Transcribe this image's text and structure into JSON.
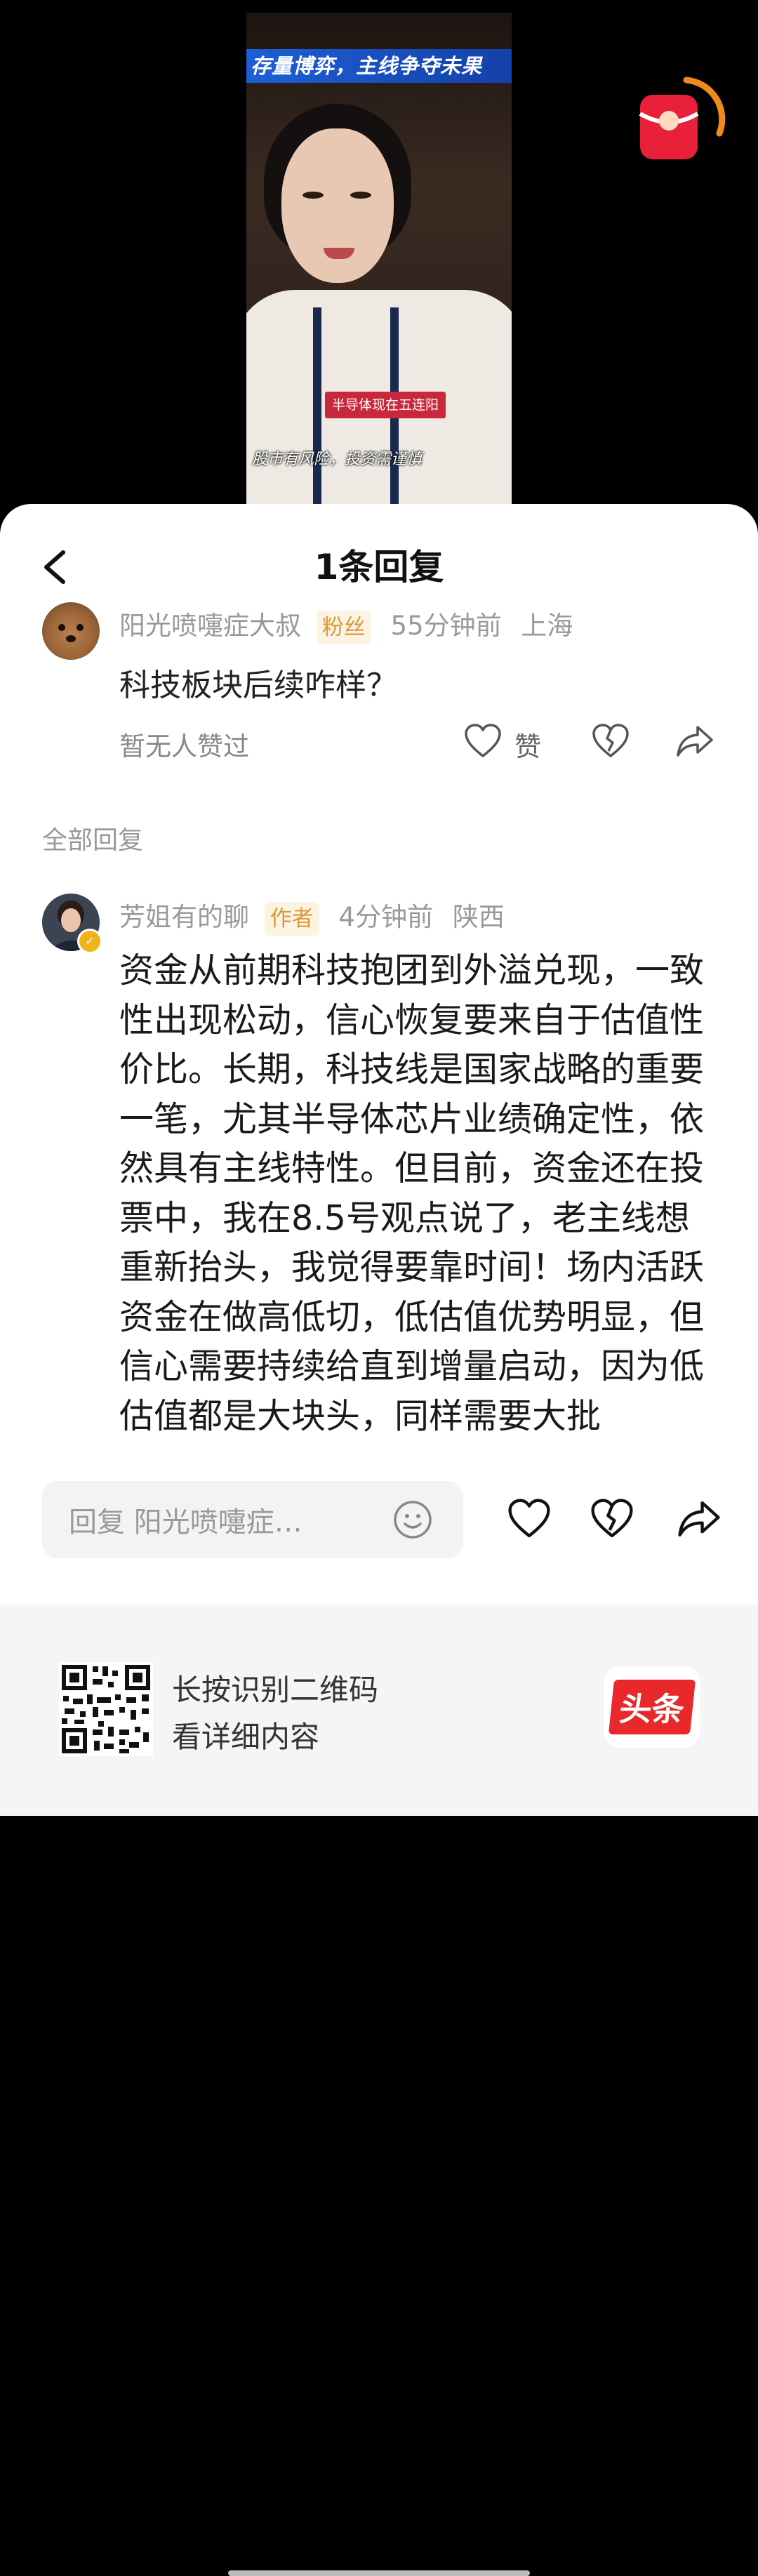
{
  "video": {
    "banner_title": "存量博弈，主线争夺未果",
    "tag": "半导体现在五连阳",
    "caption": "股市有风险，投资需谨慎"
  },
  "sheet": {
    "title": "1条回复"
  },
  "parent_comment": {
    "username": "阳光喷嚏症大叔",
    "badge": "粉丝",
    "time": "55分钟前",
    "location": "上海",
    "text": "科技板块后续咋样？",
    "like_status": "暂无人赞过",
    "like_label": "赞"
  },
  "replies_section": {
    "label": "全部回复"
  },
  "reply": {
    "username": "芳姐有的聊",
    "badge": "作者",
    "time": "4分钟前",
    "location": "陕西",
    "text": "资金从前期科技抱团到外溢兑现，一致性出现松动，信心恢复要来自于估值性价比。长期，科技线是国家战略的重要一笔，尤其半导体芯片业绩确定性，依然具有主线特性。但目前，资金还在投票中，我在8.5号观点说了，老主线想重新抬头，我觉得要靠时间！场内活跃资金在做高低切，低估值优势明显，但信心需要持续给直到增量启动，因为低估值都是大块头，同样需要大批"
  },
  "reply_bar": {
    "placeholder": "回复 阳光喷嚏症…"
  },
  "footer": {
    "qr_line_1": "长按识别二维码",
    "qr_line_2": "看详细内容",
    "brand": "头条"
  },
  "colors": {
    "accent": "#d99a3a",
    "brand_red": "#e8282a",
    "banner_blue": "#1d5fd6"
  },
  "icons": [
    "back-arrow-icon",
    "heart-icon",
    "broken-heart-icon",
    "share-icon",
    "emoji-icon",
    "red-packet-icon",
    "verified-icon",
    "qr-code-icon"
  ]
}
